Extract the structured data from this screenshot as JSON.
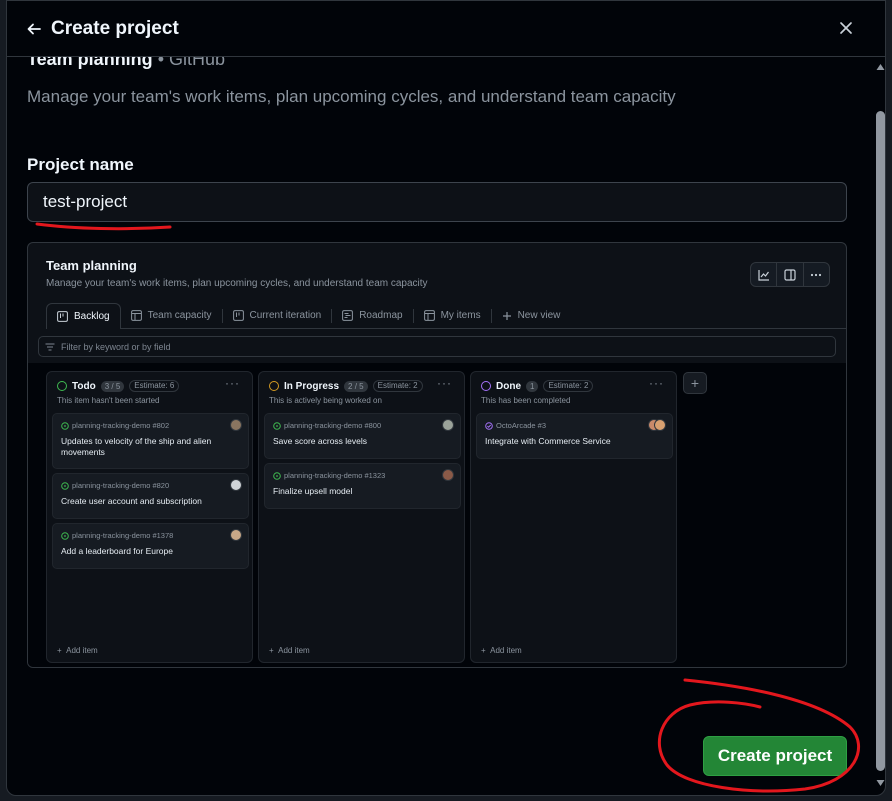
{
  "header": {
    "title": "Create project"
  },
  "template": {
    "name": "Team planning",
    "source": " • GitHub",
    "description": "Manage your team's work items, plan upcoming cycles, and understand team capacity"
  },
  "form": {
    "label": "Project name",
    "value": "test-project",
    "create_label": "Create project"
  },
  "preview": {
    "title": "Team planning",
    "description": "Manage your team's work items, plan upcoming cycles, and understand team capacity",
    "tabs": [
      {
        "label": "Backlog",
        "icon": "board-icon"
      },
      {
        "label": "Team capacity",
        "icon": "table-icon"
      },
      {
        "label": "Current iteration",
        "icon": "board-icon"
      },
      {
        "label": "Roadmap",
        "icon": "roadmap-icon"
      },
      {
        "label": "My items",
        "icon": "table-icon"
      },
      {
        "label": "New view",
        "icon": "plus-icon"
      }
    ],
    "filter_placeholder": "Filter by keyword or by field",
    "add_item": "Add item",
    "columns": [
      {
        "name": "Todo",
        "count": "3 / 5",
        "estimate": "Estimate: 6",
        "color": "#3fb950",
        "subtitle": "This item hasn't been started",
        "cards": [
          {
            "meta": "planning-tracking-demo #802",
            "title": "Updates to velocity of the ship and alien movements"
          },
          {
            "meta": "planning-tracking-demo #820",
            "title": "Create user account and subscription"
          },
          {
            "meta": "planning-tracking-demo #1378",
            "title": "Add a leaderboard for Europe"
          }
        ]
      },
      {
        "name": "In Progress",
        "count": "2 / 5",
        "estimate": "Estimate: 2",
        "color": "#d29922",
        "subtitle": "This is actively being worked on",
        "cards": [
          {
            "meta": "planning-tracking-demo #800",
            "title": "Save score across levels"
          },
          {
            "meta": "planning-tracking-demo #1323",
            "title": "Finalize upsell model"
          }
        ]
      },
      {
        "name": "Done",
        "count": "1",
        "estimate": "Estimate: 2",
        "color": "#a371f7",
        "subtitle": "This has been completed",
        "cards": [
          {
            "meta": "OctoArcade #3",
            "title": "Integrate with Commerce Service"
          }
        ]
      }
    ]
  },
  "colors": {
    "accent_green": "#238636",
    "annotation_red": "#e3171d",
    "background": "#010409"
  }
}
